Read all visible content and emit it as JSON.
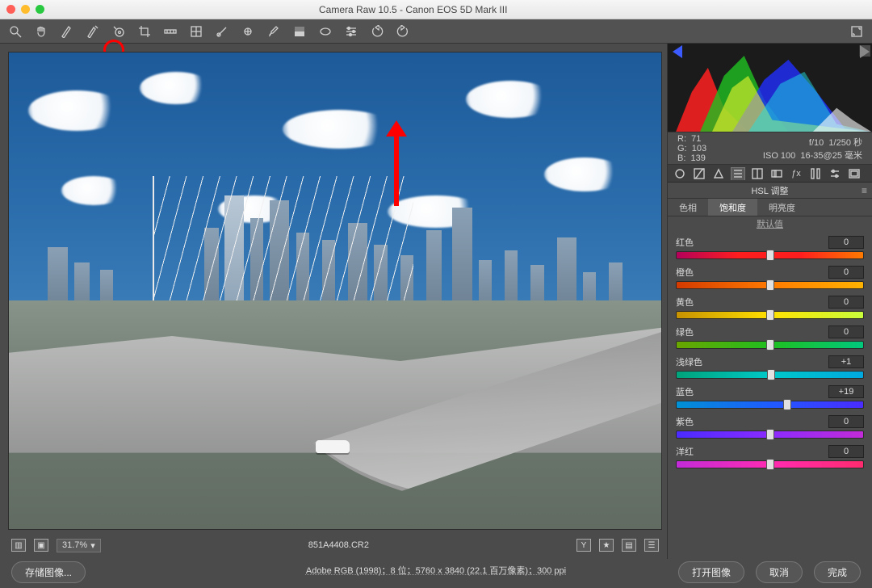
{
  "window": {
    "title": "Camera Raw 10.5  -  Canon EOS 5D Mark III"
  },
  "toolbar": {
    "tools": [
      "zoom",
      "hand",
      "white-balance",
      "color-sampler",
      "target-adjust",
      "crop",
      "straighten",
      "transform",
      "spot-removal",
      "red-eye",
      "adjustment-brush",
      "graduated-filter",
      "radial-filter",
      "preferences",
      "rotate-ccw",
      "rotate-cw"
    ],
    "highlighted_tool_index": 4,
    "fullscreen_icon": "fullscreen"
  },
  "histogram": {
    "shadow_clip_color": "#3b5bff",
    "highlight_clip_color": "#888888"
  },
  "readout": {
    "R_label": "R:",
    "R": "71",
    "G_label": "G:",
    "G": "103",
    "B_label": "B:",
    "B": "139",
    "aperture": "f/10",
    "shutter": "1/250 秒",
    "iso": "ISO 100",
    "lens": "16-35@25 毫米"
  },
  "panel_tabs": [
    "basic",
    "curve",
    "detail",
    "hsl",
    "split",
    "lens",
    "fx",
    "calib",
    "presets",
    "snap"
  ],
  "panel_tabs_active_index": 3,
  "panel": {
    "title": "HSL 调整",
    "subtabs": {
      "hue": "色相",
      "saturation": "饱和度",
      "luminance": "明亮度",
      "active": "saturation"
    },
    "defaults_label": "默认值",
    "sliders": [
      {
        "key": "reds",
        "label": "红色",
        "value": 0,
        "class": "reds"
      },
      {
        "key": "oranges",
        "label": "橙色",
        "value": 0,
        "class": "oranges"
      },
      {
        "key": "yellows",
        "label": "黄色",
        "value": 0,
        "class": "yellows"
      },
      {
        "key": "greens",
        "label": "绿色",
        "value": 0,
        "class": "greens"
      },
      {
        "key": "aquas",
        "label": "浅绿色",
        "value": 1,
        "class": "aquas"
      },
      {
        "key": "blues",
        "label": "蓝色",
        "value": 19,
        "class": "blues"
      },
      {
        "key": "purples",
        "label": "紫色",
        "value": 0,
        "class": "purples"
      },
      {
        "key": "magentas",
        "label": "洋红",
        "value": 0,
        "class": "magentas"
      }
    ]
  },
  "filmstrip": {
    "zoom": "31.7%",
    "filename": "851A4408.CR2"
  },
  "metaline": "Adobe RGB (1998)；8 位；5760 x 3840 (22.1 百万像素)；300 ppi",
  "footer": {
    "save_image": "存储图像...",
    "open_image": "打开图像",
    "cancel": "取消",
    "done": "完成"
  },
  "colors": {
    "accent_red": "#ff0000"
  }
}
